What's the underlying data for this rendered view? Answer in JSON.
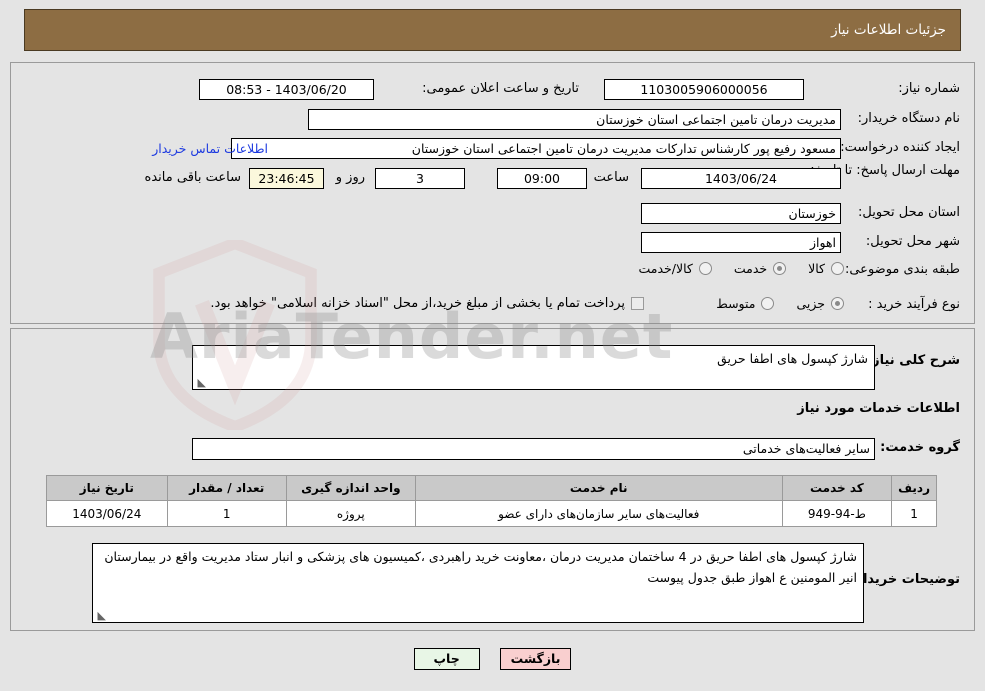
{
  "header": {
    "title": "جزئیات اطلاعات نیاز"
  },
  "top_section": {
    "need_number": {
      "label": "شماره نیاز:",
      "value": "1103005906000056"
    },
    "announce_datetime": {
      "label": "تاریخ و ساعت اعلان عمومی:",
      "value": "1403/06/20 - 08:53"
    },
    "buyer_org": {
      "label": "نام دستگاه خریدار:",
      "value": "مدیریت درمان تامین اجتماعی استان خوزستان"
    },
    "requester": {
      "label": "ایجاد کننده درخواست:",
      "value": "مسعود رفیع پور کارشناس تدارکات مدیریت درمان تامین اجتماعی استان خوزستان",
      "contact_link": "اطلاعات تماس خریدار"
    },
    "deadline": {
      "label": "مهلت ارسال پاسخ: تا تاریخ:",
      "date": "1403/06/24",
      "time_label": "ساعت",
      "time": "09:00",
      "days": "3",
      "days_label": "روز و",
      "countdown": "23:46:45",
      "countdown_label": "ساعت باقی مانده"
    },
    "delivery_province": {
      "label": "استان محل تحویل:",
      "value": "خوزستان"
    },
    "delivery_city": {
      "label": "شهر محل تحویل:",
      "value": "اهواز"
    },
    "category": {
      "label": "طبقه بندی موضوعی:",
      "options": [
        {
          "label": "کالا",
          "selected": false
        },
        {
          "label": "خدمت",
          "selected": true
        },
        {
          "label": "کالا/خدمت",
          "selected": false
        }
      ]
    },
    "purchase_type": {
      "label": "نوع فرآیند خرید :",
      "options": [
        {
          "label": "جزیی",
          "selected": true
        },
        {
          "label": "متوسط",
          "selected": false
        }
      ]
    },
    "treasury_note": {
      "checked": false,
      "text": "پرداخت تمام یا بخشی از مبلغ خرید،از محل \"اسناد خزانه اسلامی\" خواهد بود."
    }
  },
  "mid_section": {
    "general_desc": {
      "label": "شرح کلی نیاز:",
      "value": "شارژ کپسول های اطفا حریق"
    },
    "services_heading": "اطلاعات خدمات مورد نیاز",
    "service_group": {
      "label": "گروه خدمت:",
      "value": "سایر فعالیت‌های خدماتی"
    },
    "table": {
      "columns": [
        "ردیف",
        "کد خدمت",
        "نام خدمت",
        "واحد اندازه گیری",
        "تعداد / مقدار",
        "تاریخ نیاز"
      ],
      "rows": [
        [
          "1",
          "ط-94-949",
          "فعالیت‌های سایر سازمان‌های دارای عضو",
          "پروژه",
          "1",
          "1403/06/24"
        ]
      ]
    },
    "buyer_notes": {
      "label": "توضیحات خریدار:",
      "value": "شارژ کپسول های اطفا حریق  در 4 ساختمان مدیریت درمان ،معاونت خرید راهبردی ،کمیسیون های پزشکی و انبار ستاد مدیریت واقع در بیمارستان انیر المومنین ع اهواز طبق جدول پیوست"
    }
  },
  "footer": {
    "print_button": "چاپ",
    "back_button": "بازگشت"
  },
  "watermark": {
    "text": "AriaTender.net"
  },
  "colors": {
    "header_bg": "#8d6d43",
    "page_bg": "#e4e4e4",
    "link": "#1d3ae0",
    "countdown_bg": "#fbf8dc",
    "print_bg": "#e8f6e6",
    "back_bg": "#f9cfcf",
    "table_header_bg": "#c9c9c9"
  }
}
